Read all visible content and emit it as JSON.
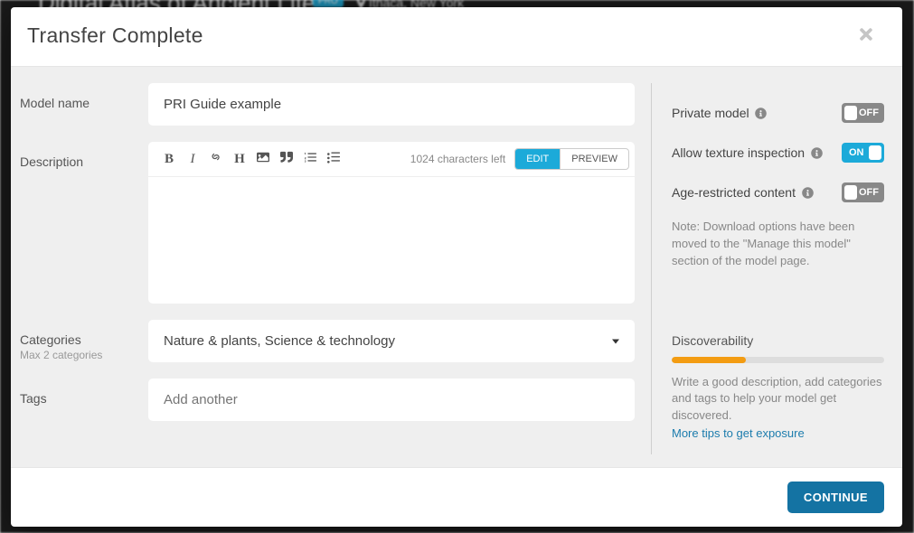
{
  "backdrop": {
    "site_title": "Digital Atlas of Ancient Life",
    "badge": "PRO",
    "location": "Ithaca, New York"
  },
  "modal": {
    "title": "Transfer Complete"
  },
  "form": {
    "model_name_label": "Model name",
    "model_name_value": "PRI Guide example",
    "description_label": "Description",
    "char_count": "1024 characters left",
    "edit_tab": "EDIT",
    "preview_tab": "PREVIEW",
    "categories_label": "Categories",
    "categories_sub": "Max 2 categories",
    "categories_value": "Nature & plants, Science & technology",
    "tags_label": "Tags",
    "tags_placeholder": "Add another"
  },
  "settings": {
    "private_label": "Private model",
    "private_state": "OFF",
    "texture_label": "Allow texture inspection",
    "texture_state": "ON",
    "age_label": "Age-restricted content",
    "age_state": "OFF",
    "note": "Note: Download options have been moved to the \"Manage this model\" section of the model page."
  },
  "discoverability": {
    "title": "Discoverability",
    "percent": 35,
    "text": "Write a good description, add categories and tags to help your model get discovered.",
    "link": "More tips to get exposure"
  },
  "footer": {
    "continue": "CONTINUE"
  }
}
